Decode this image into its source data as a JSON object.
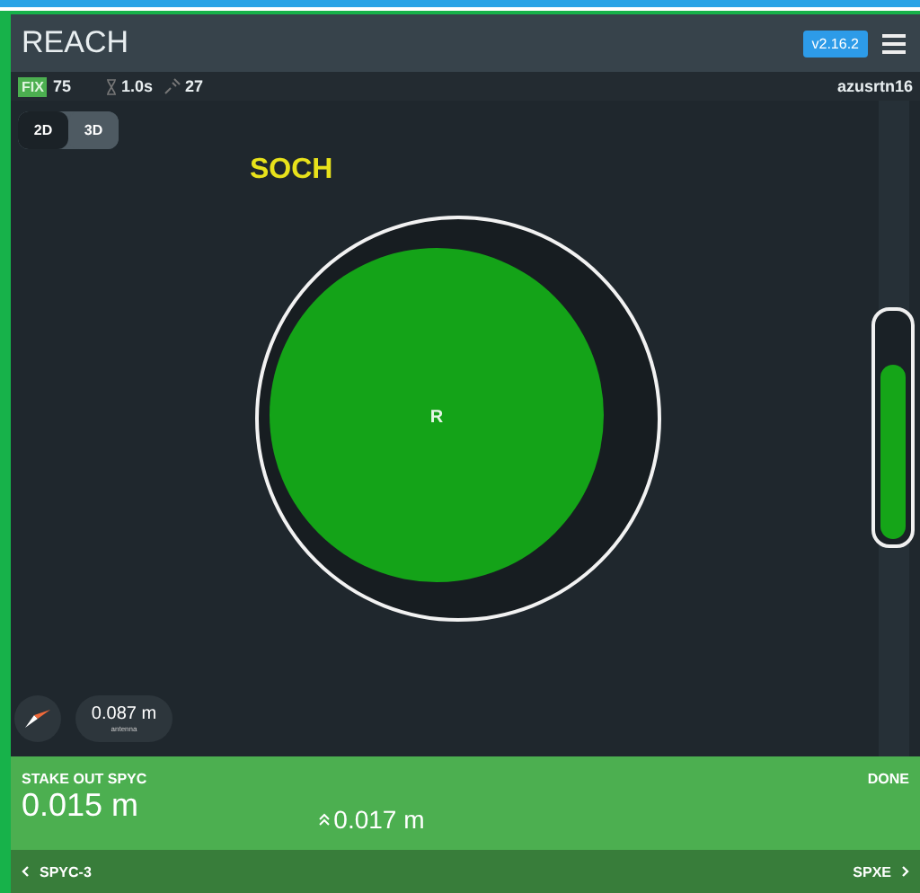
{
  "header": {
    "title": "REACH",
    "version": "v2.16.2"
  },
  "status_bar": {
    "solution": "FIX",
    "solution_value": "75",
    "age": "1.0s",
    "satellites": "27",
    "base": "azusrtn16"
  },
  "view_toggle": [
    {
      "label": "2D",
      "selected": true
    },
    {
      "label": "3D",
      "selected": false
    }
  ],
  "map": {
    "point_name": "SOCH",
    "marker_label": "R",
    "height_meter": {
      "level": 0.78
    },
    "antenna": {
      "value": "0.087 m",
      "label": "antenna"
    }
  },
  "stakeout": {
    "title": "STAKE OUT SPYC",
    "done": "DONE",
    "horizontal": "0.015 m",
    "vertical": "0.017 m"
  },
  "footer": {
    "prev": "SPYC-3",
    "next": "SPXE"
  }
}
